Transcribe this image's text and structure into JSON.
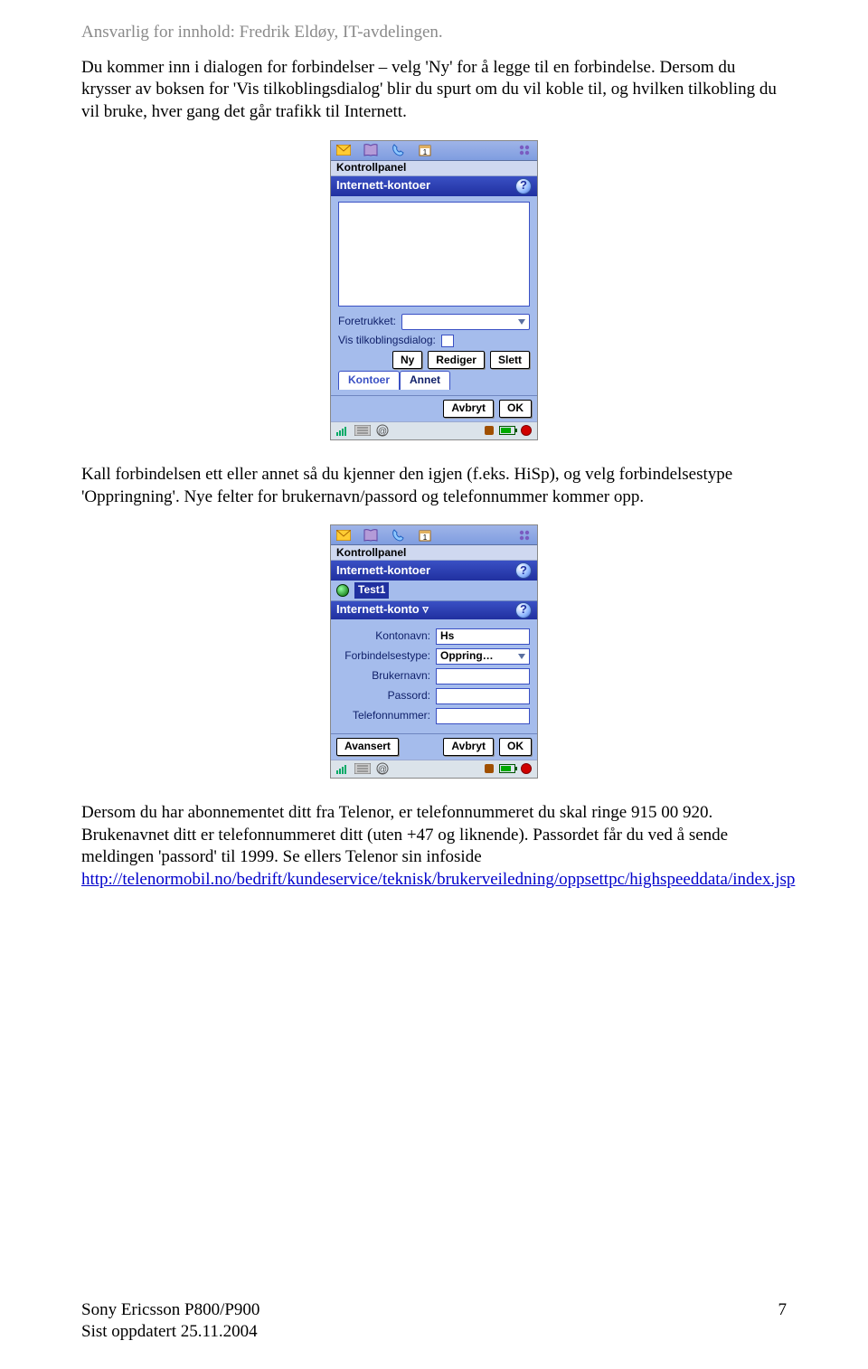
{
  "header": {
    "text": "Ansvarlig for innhold: Fredrik Eldøy, IT-avdelingen."
  },
  "p1": "Du kommer inn i dialogen for forbindelser – velg 'Ny' for å legge til en forbindelse. Dersom du krysser av boksen for 'Vis tilkoblingsdialog' blir du spurt om du vil koble til, og hvilken tilkobling du vil bruke, hver gang det går trafikk til Internett.",
  "p2": "Kall forbindelsen ett eller annet så du kjenner den igjen (f.eks. HiSp), og velg forbindelsestype 'Oppringning'. Nye felter for brukernavn/passord og telefonnummer kommer opp.",
  "p3a": "Dersom du har abonnementet ditt fra Telenor, er telefonnummeret du skal ringe 915 00 920. Brukenavnet ditt er telefonnummeret ditt (uten +47 og liknende). Passordet får du ved å sende meldingen 'passord' til 1999. Se ellers Telenor sin infoside ",
  "p3link": "http://telenormobil.no/bedrift/kundeservice/teknisk/brukerveiledning/oppsettpc/highspeeddata/index.jsp",
  "shot1": {
    "kontrollpanel": "Kontrollpanel",
    "title": "Internett-kontoer",
    "foretrukket": "Foretrukket:",
    "vis": "Vis tilkoblingsdialog:",
    "ny": "Ny",
    "rediger": "Rediger",
    "slett": "Slett",
    "tab_kontoer": "Kontoer",
    "tab_annet": "Annet",
    "avbryt": "Avbryt",
    "ok": "OK"
  },
  "shot2": {
    "kontrollpanel": "Kontrollpanel",
    "title": "Internett-kontoer",
    "item": "Test1",
    "subtitle": "Internett-konto ▿",
    "kontonavn_l": "Kontonavn:",
    "kontonavn_v": "Hs",
    "forbind_l": "Forbindelsestype:",
    "forbind_v": "Oppring…",
    "bruker_l": "Brukernavn:",
    "pass_l": "Passord:",
    "tlf_l": "Telefonnummer:",
    "avansert": "Avansert",
    "avbryt": "Avbryt",
    "ok": "OK"
  },
  "footer": {
    "left1": "Sony Ericsson P800/P900",
    "left2": "Sist oppdatert 25.11.2004",
    "right": "7"
  }
}
